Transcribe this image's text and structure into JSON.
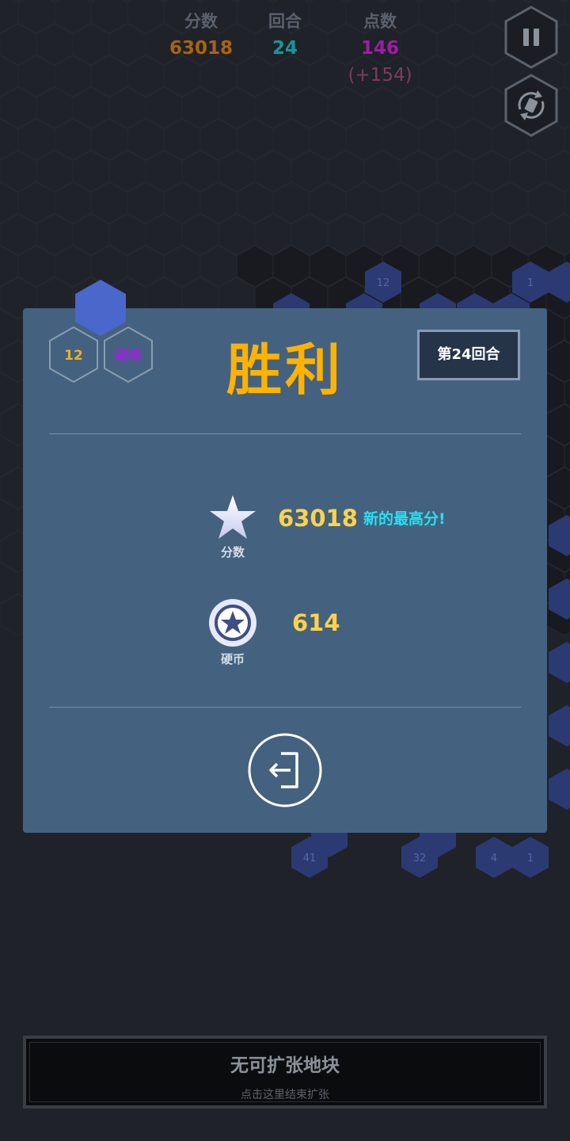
{
  "hud": {
    "score_label": "分数",
    "score_value": "63018",
    "round_label": "回合",
    "round_value": "24",
    "points_label": "点数",
    "points_value": "146",
    "points_bonus": "(+154)"
  },
  "board": {
    "tile_labels": [
      "12",
      "1",
      "41",
      "32",
      "4",
      "1"
    ]
  },
  "dialog": {
    "tile_number": "12",
    "tile_type": "硬核",
    "title": "胜利",
    "round_badge": "第24回合",
    "score": {
      "label": "分数",
      "value": "63018",
      "note": "新的最高分!"
    },
    "coins": {
      "label": "硬币",
      "value": "614"
    },
    "exit_icon": "exit-door-icon"
  },
  "bottom_button": {
    "main": "无可扩张地块",
    "sub": "点击这里结束扩张"
  },
  "colors": {
    "background": "#1f2228",
    "dialog": "#44627f",
    "title": "#ffb300",
    "score": "#a86412",
    "round": "#14989a",
    "points": "#a01ca8",
    "highscore": "#28e0f0",
    "board_tile": "#2c3a73"
  }
}
